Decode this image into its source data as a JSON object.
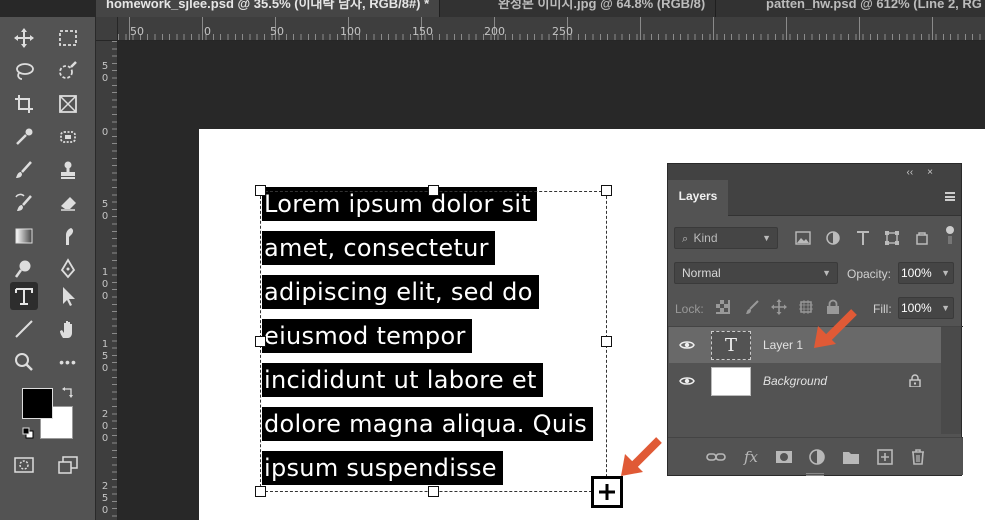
{
  "tabs": [
    {
      "label": "homework_sjlee.psd @ 35.5% (이대략 남자, RGB/8#) *",
      "active": true
    },
    {
      "label": "완성본 이미지.jpg @ 64.8% (RGB/8)",
      "active": false
    },
    {
      "label": "patten_hw.psd @ 612% (Line 2, RG",
      "active": false
    }
  ],
  "ruler": {
    "h_labels": [
      "50",
      "0",
      "50",
      "100",
      "150",
      "200",
      "250"
    ],
    "v_labels": [
      "50",
      "0",
      "50",
      "100",
      "150",
      "200",
      "250"
    ]
  },
  "canvas": {
    "text_lines": [
      "Lorem ipsum dolor sit",
      "amet, consectetur",
      "adipiscing elit, sed do",
      "eiusmod tempor",
      "incididunt ut labore et",
      "dolore magna aliqua. Quis",
      "ipsum suspendisse"
    ],
    "arrow_color": "#e05a36"
  },
  "layers_panel": {
    "collapse_glyph": "‹‹",
    "close_glyph": "×",
    "tab": "Layers",
    "filter_label": "Kind",
    "blend_mode": "Normal",
    "opacity_label": "Opacity:",
    "opacity_value": "100%",
    "lock_label": "Lock:",
    "fill_label": "Fill:",
    "fill_value": "100%",
    "layers": [
      {
        "name": "Layer 1",
        "type_glyph": "T",
        "selected": true
      },
      {
        "name": "Background",
        "type_glyph": "",
        "selected": false
      }
    ],
    "bottom_icons": [
      "link-icon",
      "fx-icon",
      "mask-icon",
      "adjustment-icon",
      "folder-icon",
      "new-layer-icon",
      "trash-icon"
    ],
    "fx_text": "fx"
  },
  "toolbar": {
    "active_tool": "type-tool",
    "tools": [
      "move-tool",
      "marquee-tool",
      "lasso-tool",
      "quick-select-tool",
      "crop-tool",
      "frame-tool",
      "eyedropper-tool",
      "healing-tool",
      "brush-tool",
      "stamp-tool",
      "history-brush-tool",
      "eraser-tool",
      "gradient-tool",
      "smudge-tool",
      "dodge-tool",
      "pen-tool",
      "type-tool",
      "path-select-tool",
      "line-tool",
      "hand-tool",
      "zoom-tool",
      "more-tools",
      "quick-mask-button",
      "screen-mode-button"
    ],
    "more_glyph": "•••",
    "fg_color": "#000000",
    "bg_color": "#ffffff"
  }
}
